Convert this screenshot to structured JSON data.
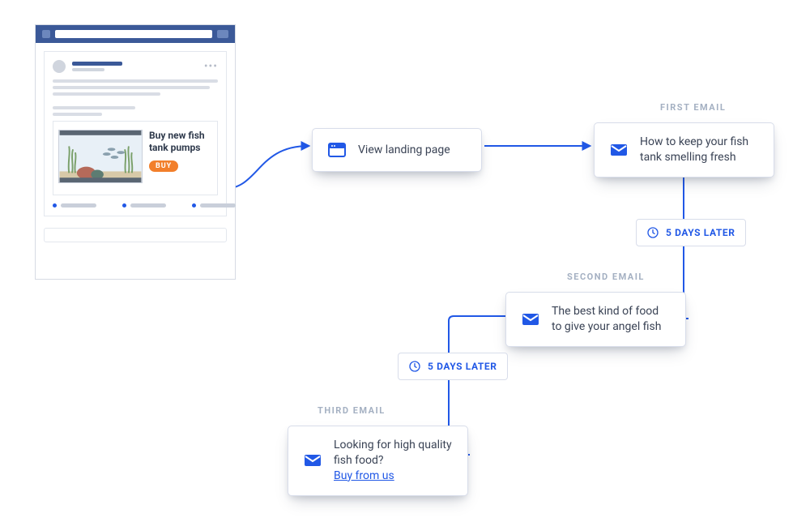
{
  "fb": {
    "ad_title": "Buy new fish tank pumps",
    "buy_label": "BUY"
  },
  "labels": {
    "first": "FIRST EMAIL",
    "second": "SECOND EMAIL",
    "third": "THIRD EMAIL"
  },
  "cards": {
    "landing": "View landing page",
    "email1": "How to keep your fish tank smelling fresh",
    "email2": "The best kind of food to give your angel fish",
    "email3_text": "Looking for high quality fish food?",
    "email3_link": "Buy from us"
  },
  "delays": {
    "d1": "5 DAYS LATER",
    "d2": "5 DAYS LATER"
  },
  "colors": {
    "accent": "#2158e6",
    "fb_blue": "#3b5998",
    "buy_orange": "#f27f2b"
  }
}
